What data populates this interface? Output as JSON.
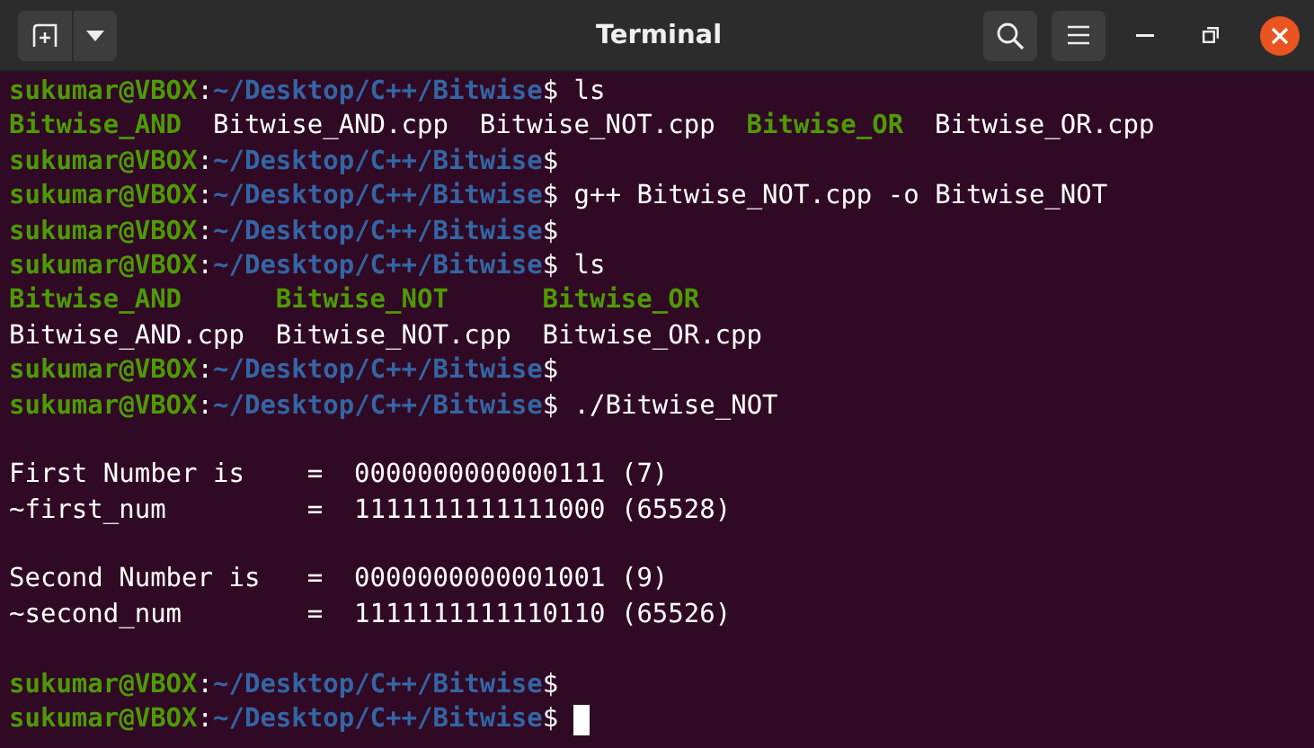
{
  "window": {
    "title": "Terminal"
  },
  "lines": [
    {
      "kind": "text",
      "spans": [
        {
          "text": "sukumar@VBOX",
          "kind": "user"
        },
        {
          "text": ":",
          "kind": "plain"
        },
        {
          "text": "~/Desktop/C++/Bitwise",
          "kind": "path"
        },
        {
          "text": "$ ls",
          "kind": "plain"
        }
      ]
    },
    {
      "kind": "listing",
      "rows": [
        [
          {
            "text": "Bitwise_AND",
            "kind": "exec"
          },
          {
            "text": "Bitwise_AND.cpp",
            "kind": "file"
          },
          {
            "text": "Bitwise_NOT.cpp",
            "kind": "file"
          },
          {
            "text": "Bitwise_OR",
            "kind": "exec"
          },
          {
            "text": "Bitwise_OR.cpp",
            "kind": "file"
          }
        ]
      ]
    },
    {
      "kind": "text",
      "spans": [
        {
          "text": "sukumar@VBOX",
          "kind": "user"
        },
        {
          "text": ":",
          "kind": "plain"
        },
        {
          "text": "~/Desktop/C++/Bitwise",
          "kind": "path"
        },
        {
          "text": "$",
          "kind": "plain"
        }
      ]
    },
    {
      "kind": "text",
      "spans": [
        {
          "text": "sukumar@VBOX",
          "kind": "user"
        },
        {
          "text": ":",
          "kind": "plain"
        },
        {
          "text": "~/Desktop/C++/Bitwise",
          "kind": "path"
        },
        {
          "text": "$ g++ Bitwise_NOT.cpp -o Bitwise_NOT",
          "kind": "plain"
        }
      ]
    },
    {
      "kind": "text",
      "spans": [
        {
          "text": "sukumar@VBOX",
          "kind": "user"
        },
        {
          "text": ":",
          "kind": "plain"
        },
        {
          "text": "~/Desktop/C++/Bitwise",
          "kind": "path"
        },
        {
          "text": "$",
          "kind": "plain"
        }
      ]
    },
    {
      "kind": "text",
      "spans": [
        {
          "text": "sukumar@VBOX",
          "kind": "user"
        },
        {
          "text": ":",
          "kind": "plain"
        },
        {
          "text": "~/Desktop/C++/Bitwise",
          "kind": "path"
        },
        {
          "text": "$ ls",
          "kind": "plain"
        }
      ]
    },
    {
      "kind": "listing",
      "rows": [
        [
          {
            "text": "Bitwise_AND",
            "kind": "exec"
          },
          {
            "text": "Bitwise_NOT",
            "kind": "exec"
          },
          {
            "text": "Bitwise_OR",
            "kind": "exec"
          }
        ],
        [
          {
            "text": "Bitwise_AND.cpp",
            "kind": "file"
          },
          {
            "text": "Bitwise_NOT.cpp",
            "kind": "file"
          },
          {
            "text": "Bitwise_OR.cpp",
            "kind": "file"
          }
        ]
      ]
    },
    {
      "kind": "text",
      "spans": [
        {
          "text": "sukumar@VBOX",
          "kind": "user"
        },
        {
          "text": ":",
          "kind": "plain"
        },
        {
          "text": "~/Desktop/C++/Bitwise",
          "kind": "path"
        },
        {
          "text": "$",
          "kind": "plain"
        }
      ]
    },
    {
      "kind": "text",
      "spans": [
        {
          "text": "sukumar@VBOX",
          "kind": "user"
        },
        {
          "text": ":",
          "kind": "plain"
        },
        {
          "text": "~/Desktop/C++/Bitwise",
          "kind": "path"
        },
        {
          "text": "$ ./Bitwise_NOT",
          "kind": "plain"
        }
      ]
    },
    {
      "kind": "blank"
    },
    {
      "kind": "text",
      "spans": [
        {
          "text": "First Number is    =  0000000000000111 (7)",
          "kind": "plain"
        }
      ]
    },
    {
      "kind": "text",
      "spans": [
        {
          "text": "~first_num         =  1111111111111000 (65528)",
          "kind": "plain"
        }
      ]
    },
    {
      "kind": "blank"
    },
    {
      "kind": "text",
      "spans": [
        {
          "text": "Second Number is   =  0000000000001001 (9)",
          "kind": "plain"
        }
      ]
    },
    {
      "kind": "text",
      "spans": [
        {
          "text": "~second_num        =  1111111111110110 (65526)",
          "kind": "plain"
        }
      ]
    },
    {
      "kind": "blank"
    },
    {
      "kind": "text",
      "spans": [
        {
          "text": "sukumar@VBOX",
          "kind": "user"
        },
        {
          "text": ":",
          "kind": "plain"
        },
        {
          "text": "~/Desktop/C++/Bitwise",
          "kind": "path"
        },
        {
          "text": "$",
          "kind": "plain"
        }
      ]
    },
    {
      "kind": "text",
      "spans": [
        {
          "text": "sukumar@VBOX",
          "kind": "user"
        },
        {
          "text": ":",
          "kind": "plain"
        },
        {
          "text": "~/Desktop/C++/Bitwise",
          "kind": "path"
        },
        {
          "text": "$",
          "kind": "plain"
        }
      ]
    }
  ]
}
